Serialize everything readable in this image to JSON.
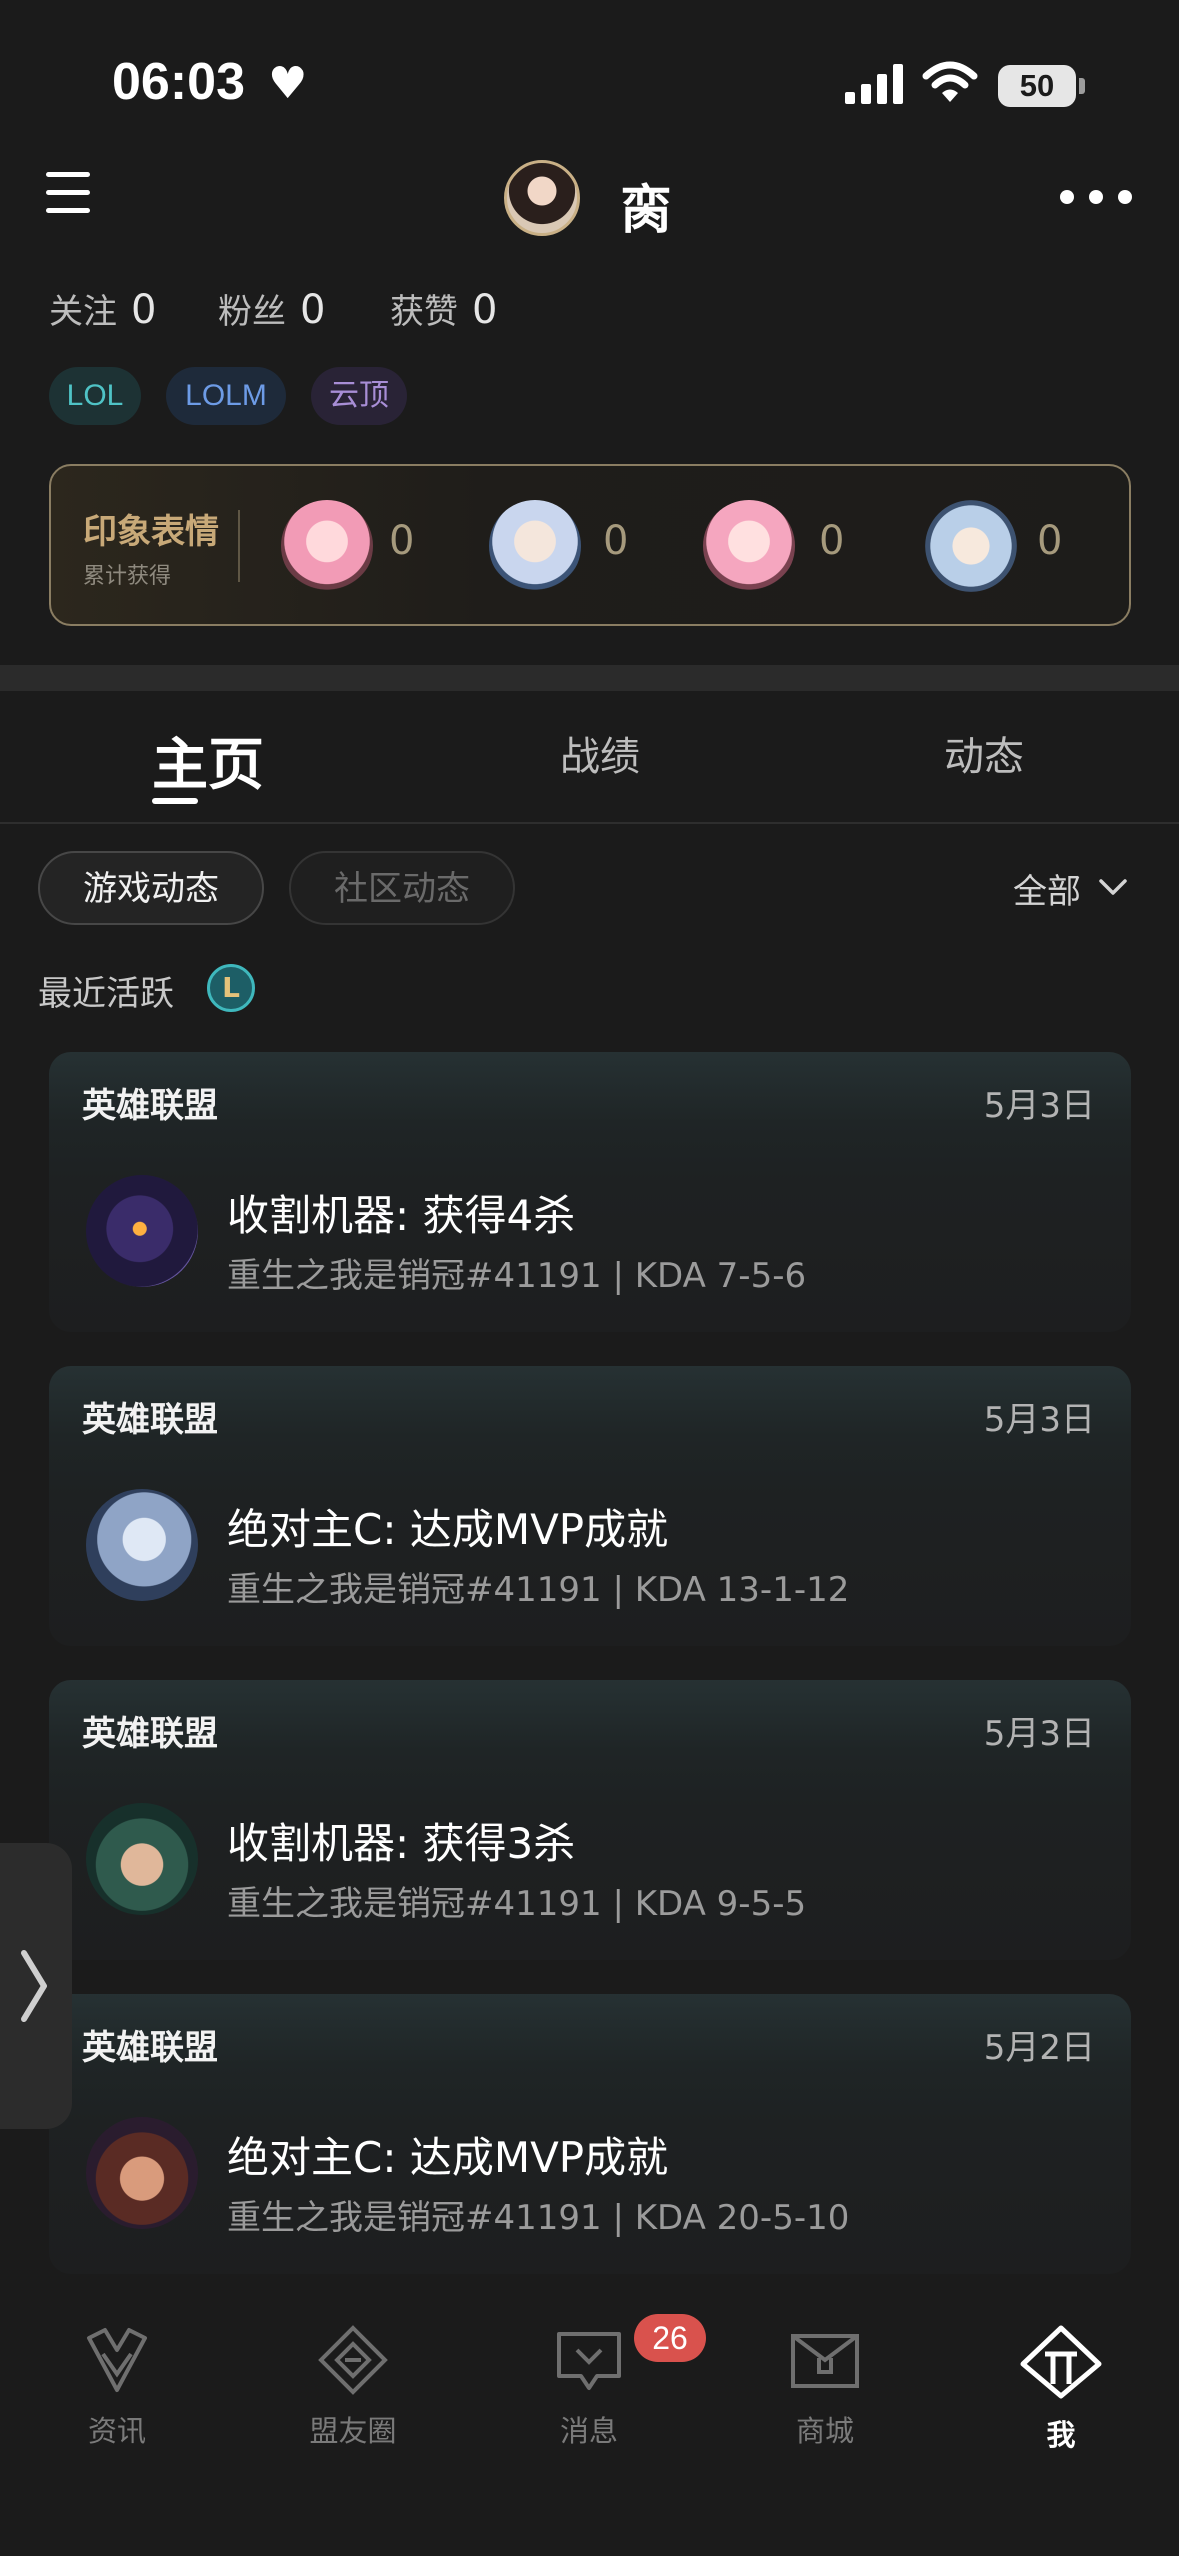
{
  "status_bar": {
    "time": "06:03",
    "battery": "50"
  },
  "header": {
    "username": "脔"
  },
  "stats": [
    {
      "label": "关注",
      "value": "0"
    },
    {
      "label": "粉丝",
      "value": "0"
    },
    {
      "label": "获赞",
      "value": "0"
    }
  ],
  "tags": [
    "LOL",
    "LOLM",
    "云顶"
  ],
  "impression": {
    "title": "印象表情",
    "subtitle": "累计获得",
    "counts": [
      "0",
      "0",
      "0",
      "0"
    ]
  },
  "tabs": [
    {
      "label": "主页",
      "active": true
    },
    {
      "label": "战绩",
      "active": false
    },
    {
      "label": "动态",
      "active": false
    }
  ],
  "chips": {
    "game": "游戏动态",
    "community": "社区动态"
  },
  "filter": {
    "label": "全部"
  },
  "recent": {
    "label": "最近活跃",
    "icon_letter": "L"
  },
  "activities": [
    {
      "game": "英雄联盟",
      "date": "5月3日",
      "headline": "收割机器: 获得4杀",
      "detail": "重生之我是销冠#41191 | KDA 7-5-6"
    },
    {
      "game": "英雄联盟",
      "date": "5月3日",
      "headline": "绝对主C: 达成MVP成就",
      "detail": "重生之我是销冠#41191 | KDA 13-1-12"
    },
    {
      "game": "英雄联盟",
      "date": "5月3日",
      "headline": "收割机器: 获得3杀",
      "detail": "重生之我是销冠#41191 | KDA 9-5-5"
    },
    {
      "game": "英雄联盟",
      "date": "5月2日",
      "headline": "绝对主C: 达成MVP成就",
      "detail": "重生之我是销冠#41191 | KDA 20-5-10"
    }
  ],
  "bottom_nav": {
    "items": [
      {
        "label": "资讯",
        "icon": "news-icon"
      },
      {
        "label": "盟友圈",
        "icon": "friends-circle-icon"
      },
      {
        "label": "消息",
        "icon": "message-icon"
      },
      {
        "label": "商城",
        "icon": "store-icon"
      },
      {
        "label": "我",
        "icon": "me-icon"
      }
    ],
    "message_badge": "26"
  },
  "colors": {
    "background": "#1b1b1b",
    "accent_gold": "#c8a978",
    "badge_red": "#d9524d",
    "tag_lol": "#4fc3c6",
    "tag_lolm": "#6d9be6",
    "tag_tft": "#a88ed6"
  }
}
